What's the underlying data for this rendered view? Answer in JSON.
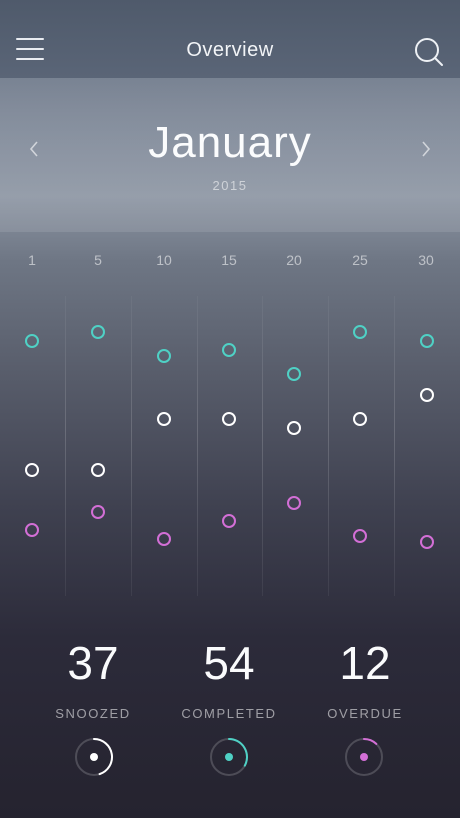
{
  "header": {
    "title": "Overview",
    "menu_icon": "menu-icon",
    "search_icon": "search-icon"
  },
  "calendar": {
    "month": "January",
    "year": "2015",
    "prev_icon": "chevron-left-icon",
    "next_icon": "chevron-right-icon"
  },
  "colors": {
    "teal": "#4fd1c5",
    "white": "#ffffff",
    "pink": "#d36fd6",
    "ring_track": "rgba(255,255,255,0.18)"
  },
  "chart_data": {
    "type": "scatter",
    "categories": [
      "1",
      "5",
      "10",
      "15",
      "20",
      "25",
      "30"
    ],
    "series": [
      {
        "color": "#4fd1c5",
        "values": [
          0.85,
          0.88,
          0.8,
          0.82,
          0.74,
          0.88,
          0.85
        ]
      },
      {
        "color": "#ffffff",
        "values": [
          0.42,
          0.42,
          0.59,
          0.59,
          0.56,
          0.59,
          0.67
        ]
      },
      {
        "color": "#d36fd6",
        "values": [
          0.22,
          0.28,
          0.19,
          0.25,
          0.31,
          0.2,
          0.18
        ]
      }
    ],
    "ylim": [
      0,
      1
    ],
    "grid": true
  },
  "stats": [
    {
      "value": "37",
      "label": "SNOOZED",
      "progress": 0.45,
      "color": "#ffffff"
    },
    {
      "value": "54",
      "label": "COMPLETED",
      "progress": 0.33,
      "color": "#4fd1c5"
    },
    {
      "value": "12",
      "label": "OVERDUE",
      "progress": 0.12,
      "color": "#d36fd6"
    }
  ]
}
